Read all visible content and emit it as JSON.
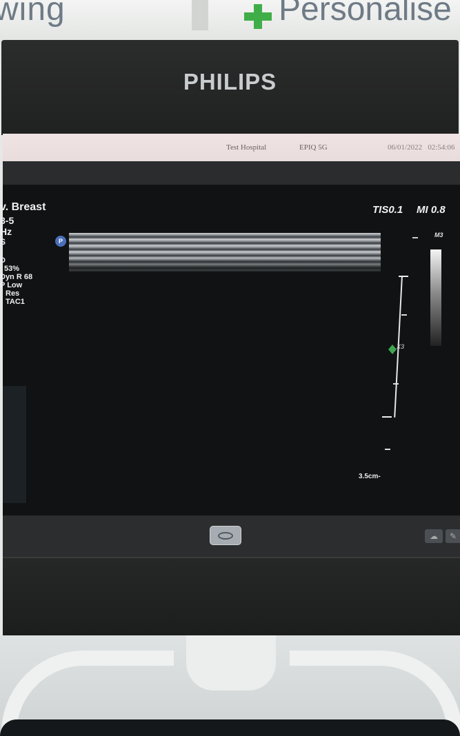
{
  "wall_banner": {
    "left_text": "wing",
    "right_text": "Personalise",
    "cross_color": "#3fae49"
  },
  "monitor": {
    "brand_logo": "PHILIPS"
  },
  "status_bar": {
    "hospital": "Test Hospital",
    "system_model": "EPIQ 5G",
    "date": "06/01/2022",
    "time": "02:54:06"
  },
  "imaging_parameters": {
    "preset": "v. Breast",
    "probe": "8-5",
    "frequency": "Hz",
    "mode": "S",
    "line1": "D",
    "gain": "53%",
    "dynamic_range": "Dyn R 68",
    "power": "P Low",
    "resolution": "Res",
    "tac": "TAC1"
  },
  "safety_indices": {
    "ti": "TIS0.1",
    "mi": "MI 0.8"
  },
  "gray_map": {
    "name": "M3"
  },
  "probe_orientation_marker": "P",
  "focus_label": "X3",
  "depth": "3.5cm",
  "controls": {
    "freeze_icon": "oval-icon",
    "cloud_icon": "cloud-icon",
    "tool_icon": "wrench-icon"
  }
}
